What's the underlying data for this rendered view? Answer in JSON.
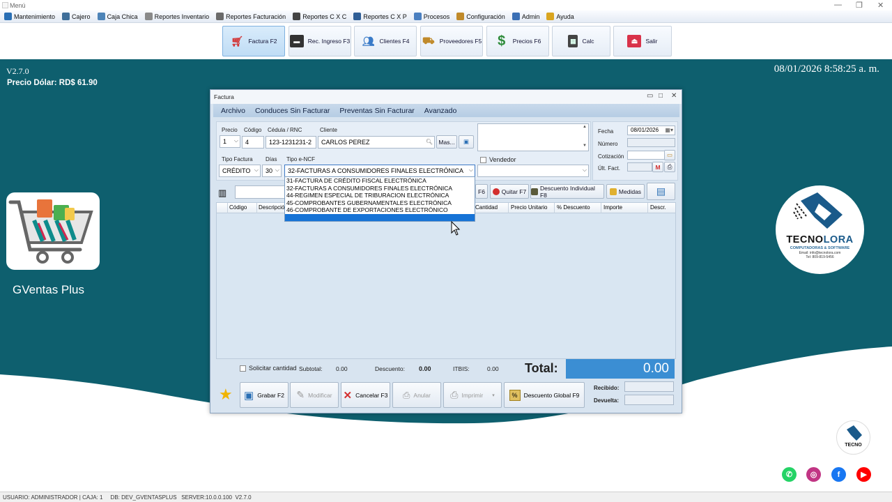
{
  "window": {
    "title": "Menú"
  },
  "menu": [
    {
      "label": "Mantenimiento",
      "icon": "maintenance-icon",
      "color": "#2a6fb5"
    },
    {
      "label": "Cajero",
      "icon": "cashier-icon",
      "color": "#3f6f9a"
    },
    {
      "label": "Caja Chica",
      "icon": "petty-cash-icon",
      "color": "#4d84b8"
    },
    {
      "label": "Reportes Inventario",
      "icon": "inventory-report-icon",
      "color": "#8a8a8a"
    },
    {
      "label": "Reportes Facturación",
      "icon": "billing-report-icon",
      "color": "#6a6a6a"
    },
    {
      "label": "Reportes C X C",
      "icon": "receivables-report-icon",
      "color": "#444444"
    },
    {
      "label": "Reportes C X P",
      "icon": "payables-report-icon",
      "color": "#2f5e96"
    },
    {
      "label": "Procesos",
      "icon": "process-icon",
      "color": "#4a7fc0"
    },
    {
      "label": "Configuración",
      "icon": "settings-icon",
      "color": "#c08a2a"
    },
    {
      "label": "Admin",
      "icon": "admin-icon",
      "color": "#3a6fb5"
    },
    {
      "label": "Ayuda",
      "icon": "help-icon",
      "color": "#d9a520"
    }
  ],
  "toolbar": [
    {
      "label": "Factura F2",
      "icon": "cart-icon",
      "color": "#d32f2f",
      "active": true
    },
    {
      "label": "Rec. Ingreso F3",
      "icon": "wallet-icon",
      "color": "#333333"
    },
    {
      "label": "Clientes F4",
      "icon": "clients-icon",
      "color": "#3a7bc8"
    },
    {
      "label": "Proveedores F5",
      "icon": "truck-icon",
      "color": "#c08a2a"
    },
    {
      "label": "Precios F6",
      "icon": "dollar-icon",
      "color": "#2e8b3a"
    },
    {
      "label": "Calc",
      "icon": "calculator-icon",
      "color": "#444444"
    },
    {
      "label": "Salir",
      "icon": "exit-icon",
      "color": "#d9334a"
    }
  ],
  "info": {
    "version": "V2.7.0",
    "dollar_rate": "Precio Dólar: RD$ 61.90",
    "datetime": "08/01/2026 8:58:25 a. m.",
    "app_name": "GVentas Plus"
  },
  "brand": {
    "name_a": "TECNO",
    "name_b": "LORA",
    "tagline": "COMPUTADORAS & SOFTWARE",
    "email": "Email: info@tecnolora.com",
    "phone": "Tel: 809-819-5456"
  },
  "social": [
    {
      "icon": "whatsapp-icon",
      "color": "#25d366",
      "glyph": "✆"
    },
    {
      "icon": "instagram-icon",
      "color": "#c13584",
      "glyph": "◎"
    },
    {
      "icon": "facebook-icon",
      "color": "#1877f2",
      "glyph": "f"
    },
    {
      "icon": "youtube-icon",
      "color": "#ff0000",
      "glyph": "▶"
    }
  ],
  "status_bar": "USUARIO: ADMINISTRADOR | CAJA: 1     DB: DEV_GVENTASPLUS   SERVER:10.0.0.100  V2.7.0",
  "dialog": {
    "title": "Factura",
    "menu": [
      "Archivo",
      "Conduces Sin Facturar",
      "Preventas Sin Facturar",
      "Avanzado"
    ],
    "labels": {
      "precio": "Precio",
      "codigo": "Código",
      "cedula": "Cédula / RNC",
      "cliente": "Cliente",
      "tipo_factura": "Tipo Factura",
      "dias": "Días",
      "tipo_encf": "Tipo e-NCF",
      "vendedor": "Vendedor",
      "fecha": "Fecha",
      "numero": "Número",
      "cotizacion": "Cotización",
      "ult_fact": "Últ. Fact."
    },
    "values": {
      "precio": "1",
      "codigo": "4",
      "cedula": "123-1231231-2",
      "cliente": "CARLOS PEREZ",
      "tipo_factura": "CRÉDITO",
      "dias": "30",
      "tipo_encf": "32-FACTURAS A CONSUMIDORES FINALES ELECTRÓNICA",
      "fecha": "08/01/2026"
    },
    "mas_button": "Mas...",
    "encf_options": [
      "31-FACTURA DE CRÉDITO FISCAL ELECTRÓNICA",
      "32-FACTURAS A CONSUMIDORES FINALES ELECTRÓNICA",
      "44-REGIMEN ESPECIAL DE TRIBURACION ELECTRÓNICA",
      "45-COMPROBANTES GUBERNAMENTALES ELECTRÓNICA",
      "46-COMPROBANTE DE EXPORTACIONES ELECTRÓNICO"
    ],
    "actions": {
      "f6_partial": "F6",
      "quitar": "Quitar F7",
      "descuento_individual": "Descuento Individual F8",
      "medidas": "Medidas"
    },
    "grid_columns": [
      "Código",
      "Descripción",
      "Cantidad",
      "Precio Unitario",
      "% Descuento",
      "Importe",
      "Descr."
    ],
    "footer": {
      "solicitar_cantidad": "Solicitar cantidad",
      "subtotal_label": "Subtotal:",
      "subtotal": "0.00",
      "descuento_label": "Descuento:",
      "descuento": "0.00",
      "itbis_label": "ITBIS:",
      "itbis": "0.00",
      "total_label": "Total:",
      "total": "0.00",
      "recibido_label": "Recibido:",
      "devuelta_label": "Devuelta:"
    },
    "buttons": {
      "grabar": "Grabar F2",
      "modificar": "Modificar",
      "cancelar": "Cancelar F3",
      "anular": "Anular",
      "imprimir": "Imprimir",
      "descuento_global": "Descuento Global F9"
    }
  }
}
